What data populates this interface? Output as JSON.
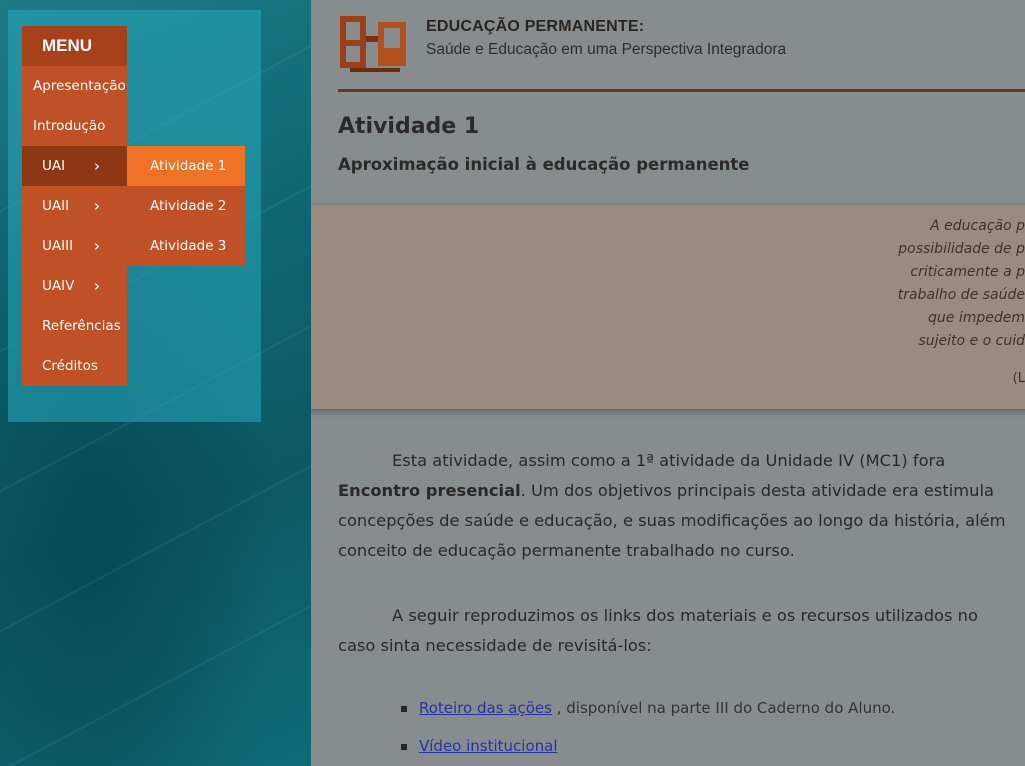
{
  "menu": {
    "title": "MENU",
    "items": [
      {
        "label": "Apresentação",
        "has_submenu": false
      },
      {
        "label": "Introdução",
        "has_submenu": false
      },
      {
        "label": "UAI",
        "has_submenu": true,
        "active": true
      },
      {
        "label": "UAII",
        "has_submenu": true
      },
      {
        "label": "UAIII",
        "has_submenu": true
      },
      {
        "label": "UAIV",
        "has_submenu": true
      },
      {
        "label": "Referências",
        "has_submenu": false
      },
      {
        "label": "Créditos",
        "has_submenu": false
      }
    ],
    "chevron_icon": "chevron-right-icon",
    "submenu": [
      {
        "label": "Atividade 1",
        "current": true
      },
      {
        "label": "Atividade 2"
      },
      {
        "label": "Atividade 3"
      }
    ]
  },
  "header": {
    "title": "EDUCAÇÃO PERMANENTE:",
    "subtitle": "Saúde e Educação em uma Perspectiva Integradora"
  },
  "page": {
    "title": "Atividade 1",
    "subtitle": "Aproximação inicial à educação permanente"
  },
  "quote": {
    "lines": [
      "A educação p",
      "possibilidade de p",
      "criticamente a p",
      "trabalho de saúde",
      "que impedem",
      "sujeito e o cuid"
    ],
    "cite": "(L"
  },
  "paragraph1": {
    "line1": "Esta atividade, assim como a 1ª atividade da Unidade IV (MC1) fora",
    "line2_bold": "Encontro presencial",
    "line2_rest": ". Um dos objetivos principais desta atividade era estimula",
    "line3": "concepções de saúde e educação, e suas modificações ao longo da história, além",
    "line4": "conceito de educação permanente trabalhado no curso."
  },
  "paragraph2": {
    "line1": "A seguir reproduzimos os links dos materiais e os recursos utilizados no",
    "line2": "caso sinta necessidade de revisitá-los:"
  },
  "resources": [
    {
      "link": "Roteiro das ações",
      "rest": " , disponível na parte III do Caderno do Aluno."
    },
    {
      "link": "Vídeo institucional",
      "rest": ""
    }
  ],
  "colors": {
    "menu_bg": "#c05126",
    "menu_title_bg": "#a7411c",
    "menu_active_bg": "#8e3714",
    "submenu_current_bg": "#f07226",
    "teal_panel": "#0f6673",
    "quote_bg": "#9a8b80",
    "link": "#2433a8"
  }
}
